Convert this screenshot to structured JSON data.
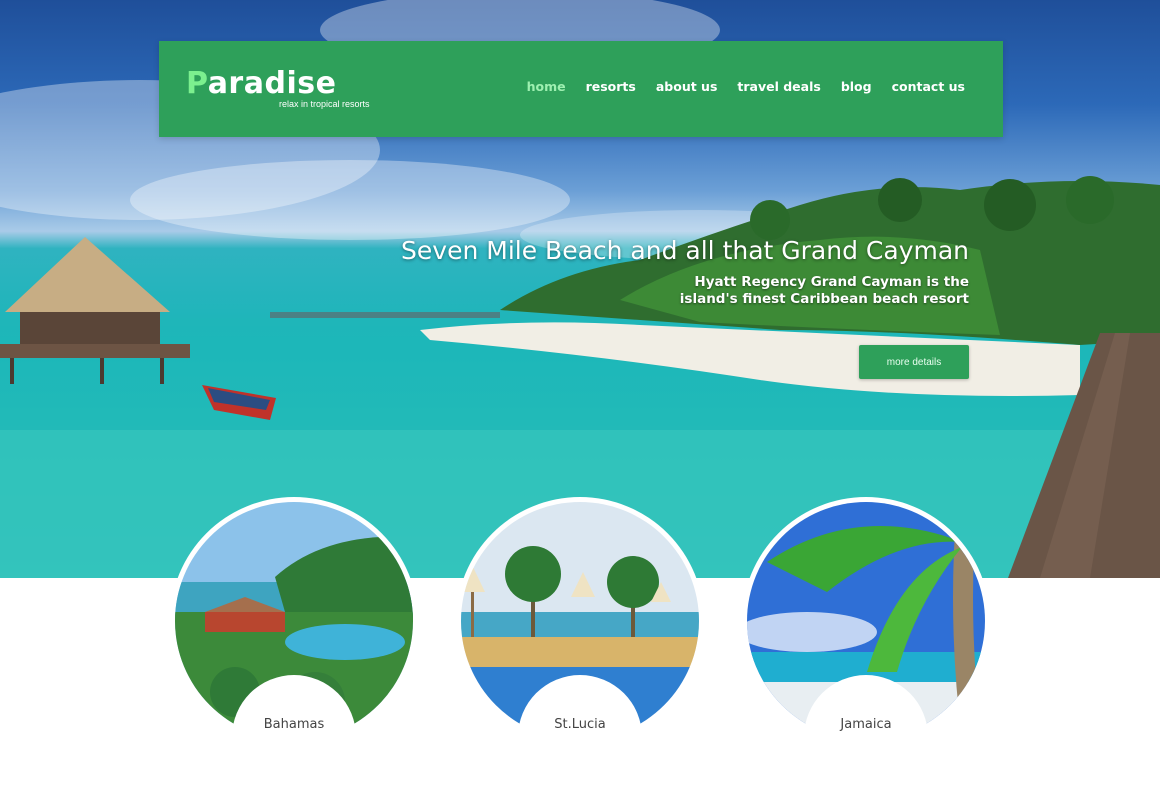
{
  "brand": {
    "logo_first": "P",
    "logo_rest": "aradise",
    "tagline": "relax in tropical resorts"
  },
  "nav": {
    "items": [
      {
        "label": "home",
        "active": true
      },
      {
        "label": "resorts",
        "active": false
      },
      {
        "label": "about us",
        "active": false
      },
      {
        "label": "travel deals",
        "active": false
      },
      {
        "label": "blog",
        "active": false
      },
      {
        "label": "contact us",
        "active": false
      }
    ]
  },
  "hero": {
    "title": "Seven Mile Beach and all that Grand Cayman",
    "subtitle": "Hyatt Regency Grand Cayman is the island's finest Caribbean beach resort",
    "button": "more details"
  },
  "destinations": [
    {
      "name": "Bahamas"
    },
    {
      "name": "St.Lucia"
    },
    {
      "name": "Jamaica"
    }
  ],
  "colors": {
    "primary": "#2ea05a",
    "active_nav": "#9ef0b1",
    "logo_accent": "#7cf08f"
  }
}
